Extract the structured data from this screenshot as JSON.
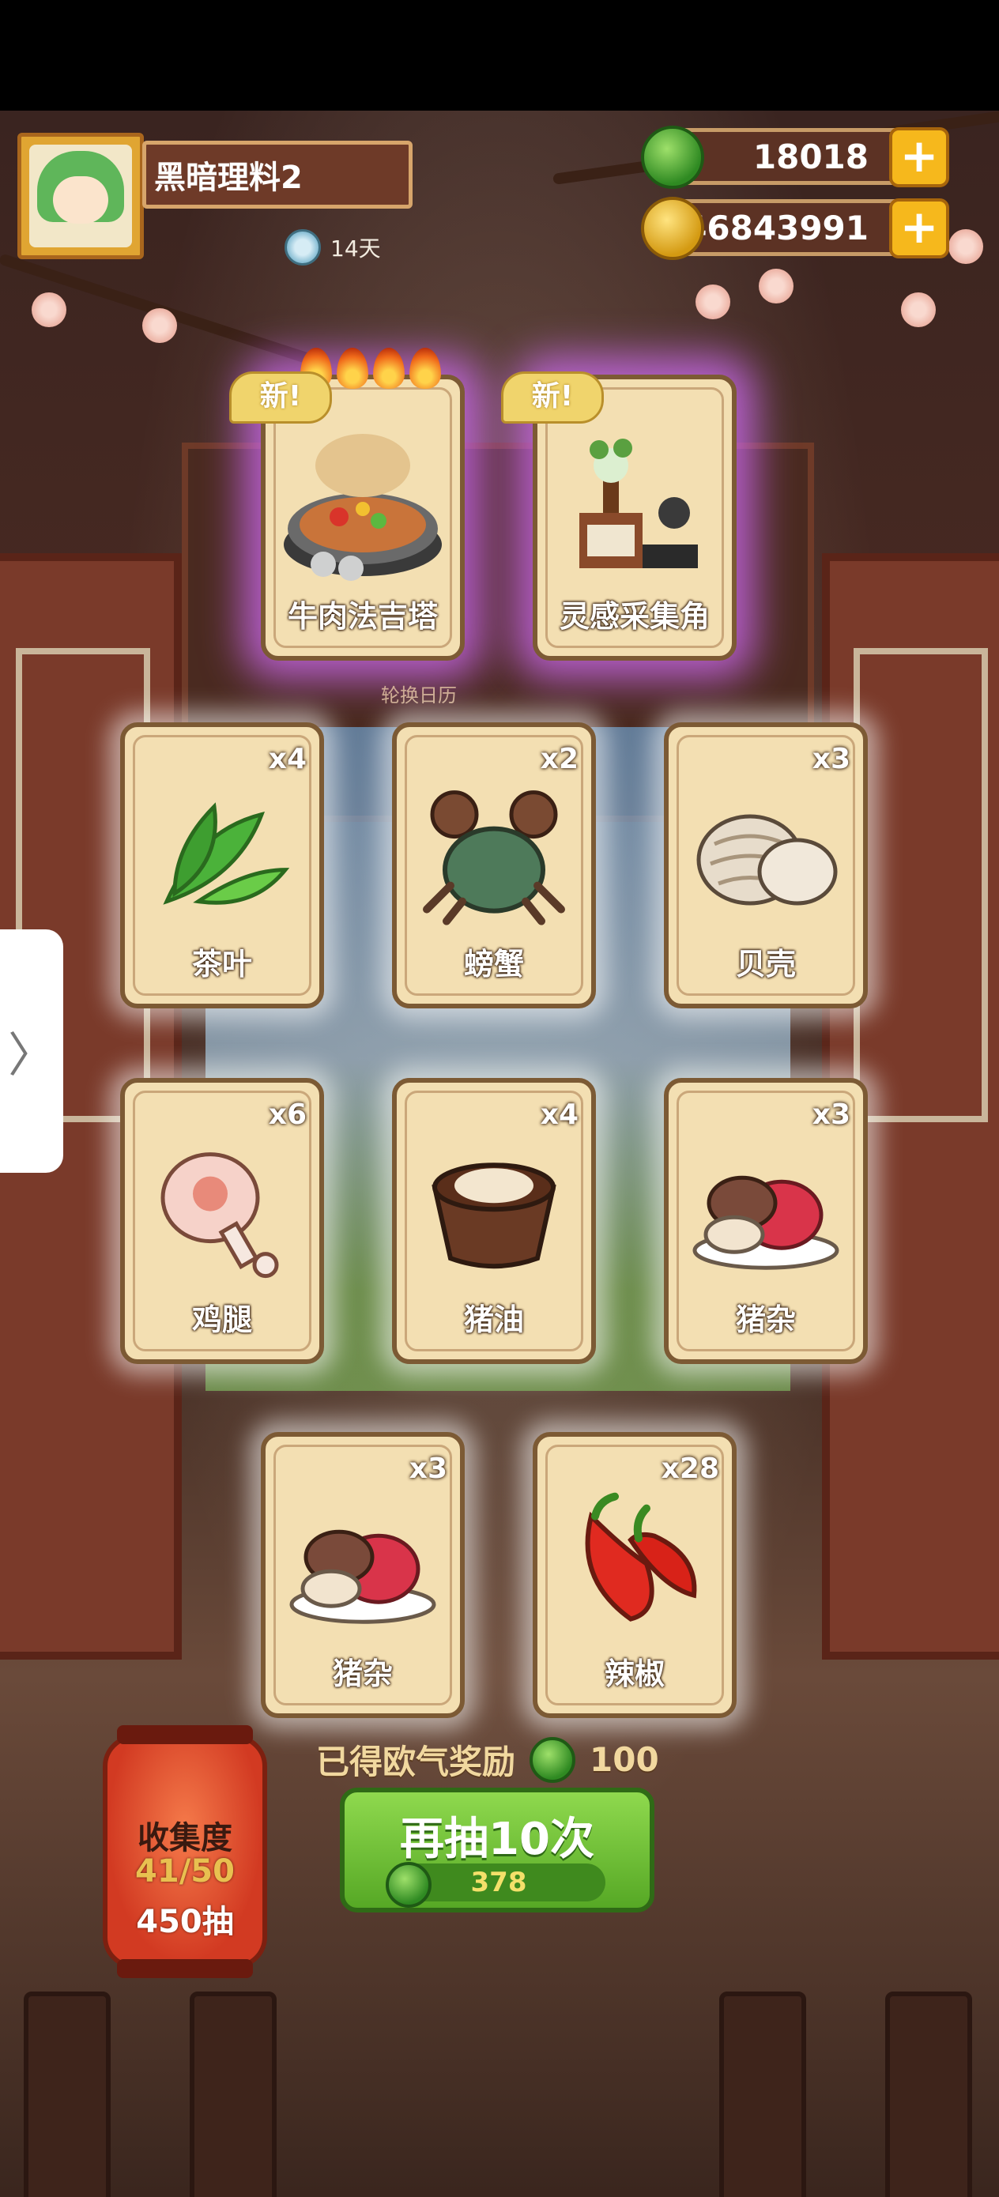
{
  "player": {
    "name": "黑暗理料2",
    "days": "14天"
  },
  "currencies": {
    "jade": "18018",
    "coins": "46843991",
    "plus": "+"
  },
  "featured": [
    {
      "name": "牛肉法吉塔",
      "tag": "新!",
      "icon": "fajita-dish-icon"
    },
    {
      "name": "灵感采集角",
      "tag": "新!",
      "icon": "inspiration-corner-icon"
    }
  ],
  "rotate_label": "轮换日历",
  "items": [
    {
      "name": "茶叶",
      "count": "x4",
      "icon": "tea-leaf-icon"
    },
    {
      "name": "螃蟹",
      "count": "x2",
      "icon": "crab-icon"
    },
    {
      "name": "贝壳",
      "count": "x3",
      "icon": "shell-icon"
    },
    {
      "name": "鸡腿",
      "count": "x6",
      "icon": "chicken-leg-icon"
    },
    {
      "name": "猪油",
      "count": "x4",
      "icon": "lard-icon"
    },
    {
      "name": "猪杂",
      "count": "x3",
      "icon": "pork-offal-icon"
    },
    {
      "name": "猪杂",
      "count": "x3",
      "icon": "pork-offal-icon"
    },
    {
      "name": "辣椒",
      "count": "x28",
      "icon": "chili-pepper-icon"
    }
  ],
  "side_tab": "〉",
  "reward": {
    "text": "已得欧气奖励",
    "amount": "100"
  },
  "collection": {
    "title": "收集度",
    "progress": "41/50",
    "draws": "450抽"
  },
  "draw_button": {
    "label": "再抽10次",
    "cost": "378"
  },
  "colors": {
    "jade": "#3fa02a",
    "coin": "#e0a818",
    "glow": "#d66eff",
    "button_green": "#6cc03a"
  }
}
